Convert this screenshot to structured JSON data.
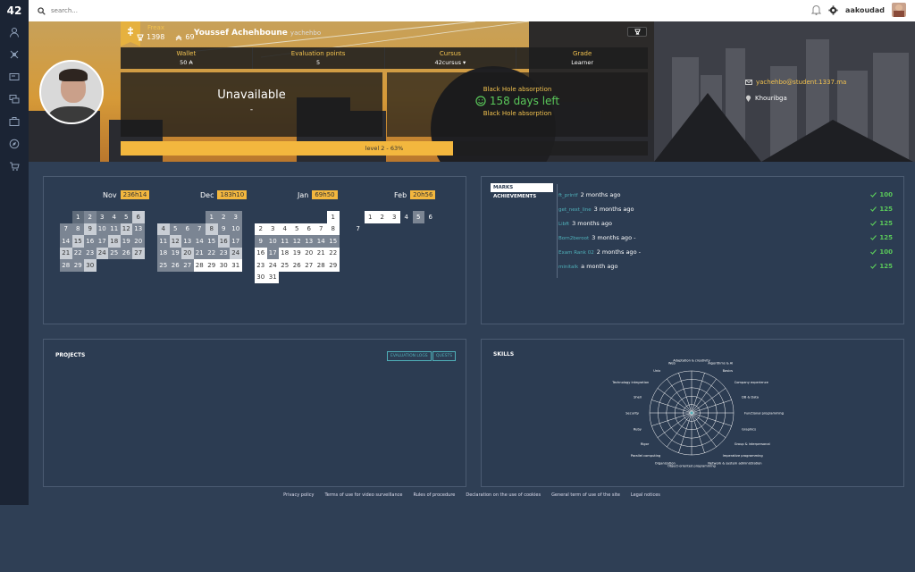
{
  "topbar": {
    "logo": "42",
    "search_placeholder": "search...",
    "login": "aakoudad",
    "icons": [
      "search-icon",
      "bell-icon",
      "gear-icon"
    ]
  },
  "sidebar": {
    "icons": [
      "user-icon",
      "crosshair-icon",
      "id-card-icon",
      "chat-icon",
      "briefcase-icon",
      "compass-icon",
      "cart-icon"
    ]
  },
  "profile": {
    "coalition": "Freax",
    "trophy_count": "1398",
    "rank_count": "69",
    "display_name": "Youssef Achehboune",
    "login": "yachehbo",
    "stats": [
      {
        "label": "Wallet",
        "value": "50 ₳"
      },
      {
        "label": "Evaluation points",
        "value": "5"
      },
      {
        "label": "Cursus",
        "value": "42cursus ▾"
      },
      {
        "label": "Grade",
        "value": "Learner"
      }
    ],
    "availability": "Unavailable",
    "availability_sub": "-",
    "blackhole_title": "Black Hole absorption",
    "blackhole_days": "158 days left",
    "blackhole_footer": "Black Hole absorption",
    "level_text": "level 2 - 63%",
    "level_percent": 63,
    "email": "yachehbo@student.1337.ma",
    "location": "Khouribga"
  },
  "calendar": {
    "months": [
      {
        "name": "Nov",
        "hours": "236h14"
      },
      {
        "name": "Dec",
        "hours": "183h10"
      },
      {
        "name": "Jan",
        "hours": "69h50"
      },
      {
        "name": "Feb",
        "hours": "20h56"
      }
    ]
  },
  "marks": {
    "tabs": [
      "MARKS",
      "ACHIEVEMENTS"
    ],
    "rows": [
      {
        "project": "ft_printf",
        "time": "2 months ago",
        "score": "100"
      },
      {
        "project": "get_next_line",
        "time": "3 months ago",
        "score": "125"
      },
      {
        "project": "Libft",
        "time": "3 months ago",
        "score": "125"
      },
      {
        "project": "Born2beroot",
        "time": "3 months ago -",
        "score": "125"
      },
      {
        "project": "Exam Rank 02",
        "time": "2 months ago -",
        "score": "100"
      },
      {
        "project": "minitalk",
        "time": "a month ago",
        "score": "125"
      }
    ]
  },
  "projects": {
    "title": "PROJECTS",
    "buttons": [
      "EVALUATION LOGS",
      "QUESTS"
    ]
  },
  "skills": {
    "title": "SKILLS",
    "labels": [
      "Adaptation & creativity",
      "Algorithms & AI",
      "Basics",
      "Company experience",
      "DB & Data",
      "Functional programming",
      "Graphics",
      "Group & interpersonal",
      "Imperative programming",
      "Network & system administration",
      "Object-oriented programming",
      "Organization",
      "Parallel computing",
      "Rigor",
      "Ruby",
      "Security",
      "Shell",
      "Technology integration",
      "Unix",
      "Web"
    ]
  },
  "footer": {
    "links": [
      "Privacy policy",
      "Terms of use for video surveillance",
      "Rules of procedure",
      "Declaration on the use of cookies",
      "General term of use of the site",
      "Legal notices"
    ]
  },
  "colors": {
    "accent": "#f3b73e",
    "teal": "#4fb0b9",
    "green": "#5ac85a",
    "card_bg": "#2c3c52"
  }
}
